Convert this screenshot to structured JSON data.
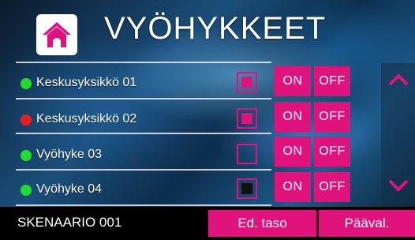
{
  "header": {
    "title": "VYÖHYKKEET",
    "home_icon": "home-icon"
  },
  "zones": [
    {
      "label": "Keskusyksikkö 01",
      "status": "green",
      "selected": true
    },
    {
      "label": "Keskusyksikkö 02",
      "status": "red",
      "selected": true
    },
    {
      "label": "Vyöhyke 03",
      "status": "green",
      "selected": false
    },
    {
      "label": "Vyöhyke 04",
      "status": "green",
      "selected": true
    }
  ],
  "buttons": {
    "on_label": "ON",
    "off_label": "OFF"
  },
  "scroll": {
    "up_icon": "chevron-up-icon",
    "down_icon": "chevron-down-icon"
  },
  "footer": {
    "scenario": "SKENAARIO 001",
    "prev_level": "Ed. taso",
    "main_view": "Pääval."
  },
  "colors": {
    "accent": "#e0137d",
    "status_green": "#1fdd2a",
    "status_red": "#ee1c1c"
  }
}
